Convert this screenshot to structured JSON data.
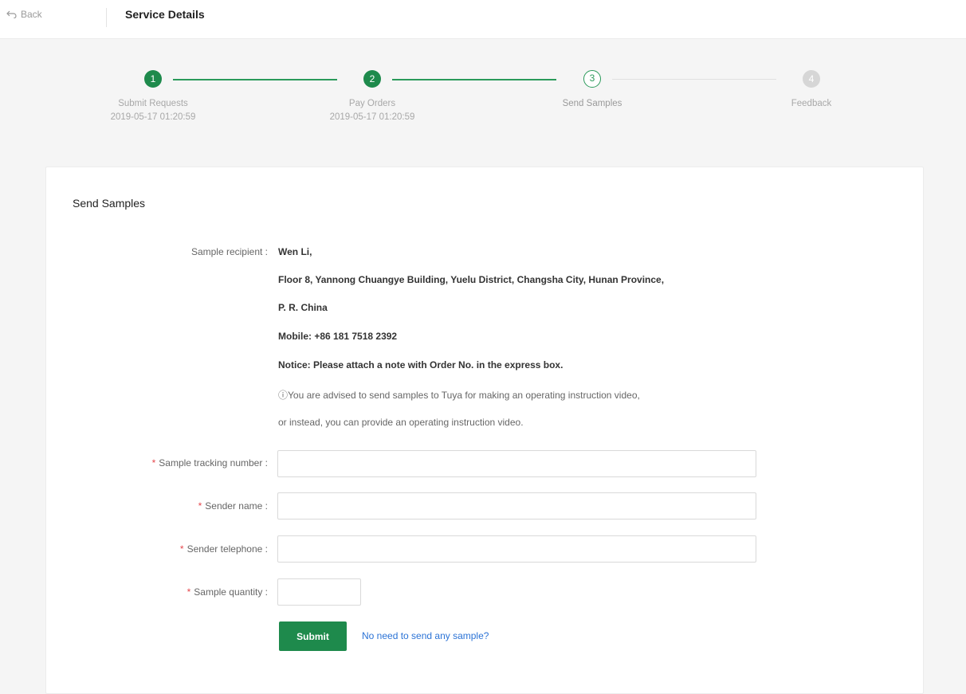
{
  "header": {
    "back_label": "Back",
    "title": "Service Details"
  },
  "steps": [
    {
      "number": "1",
      "label": "Submit Requests",
      "time": "2019-05-17 01:20:59",
      "state": "done"
    },
    {
      "number": "2",
      "label": "Pay Orders",
      "time": "2019-05-17 01:20:59",
      "state": "done"
    },
    {
      "number": "3",
      "label": "Send Samples",
      "time": "",
      "state": "current"
    },
    {
      "number": "4",
      "label": "Feedback",
      "time": "",
      "state": "todo"
    }
  ],
  "section": {
    "title": "Send Samples",
    "recipient_label": "Sample recipient :",
    "recipient_lines": [
      "Wen Li,",
      "Floor 8, Yannong Chuangye Building, Yuelu District, Changsha City, Hunan Province,",
      "P. R. China",
      "Mobile: +86 181 7518 2392",
      "Notice: Please attach a note with Order No. in the express box."
    ],
    "advice_lines": [
      "ⓘYou are advised to send samples to Tuya for making an operating instruction video,",
      "or instead, you can provide an operating instruction video."
    ]
  },
  "form": {
    "tracking_label": "Sample tracking number :",
    "tracking_value": "",
    "sender_name_label": "Sender name :",
    "sender_name_value": "",
    "sender_phone_label": "Sender telephone :",
    "sender_phone_value": "",
    "quantity_label": "Sample quantity :",
    "quantity_value": "",
    "required_mark": "*",
    "submit_label": "Submit",
    "skip_link": "No need to send any sample?"
  },
  "colors": {
    "accent": "#1e8a4c",
    "link": "#2b73d6",
    "required": "#e5484d"
  }
}
